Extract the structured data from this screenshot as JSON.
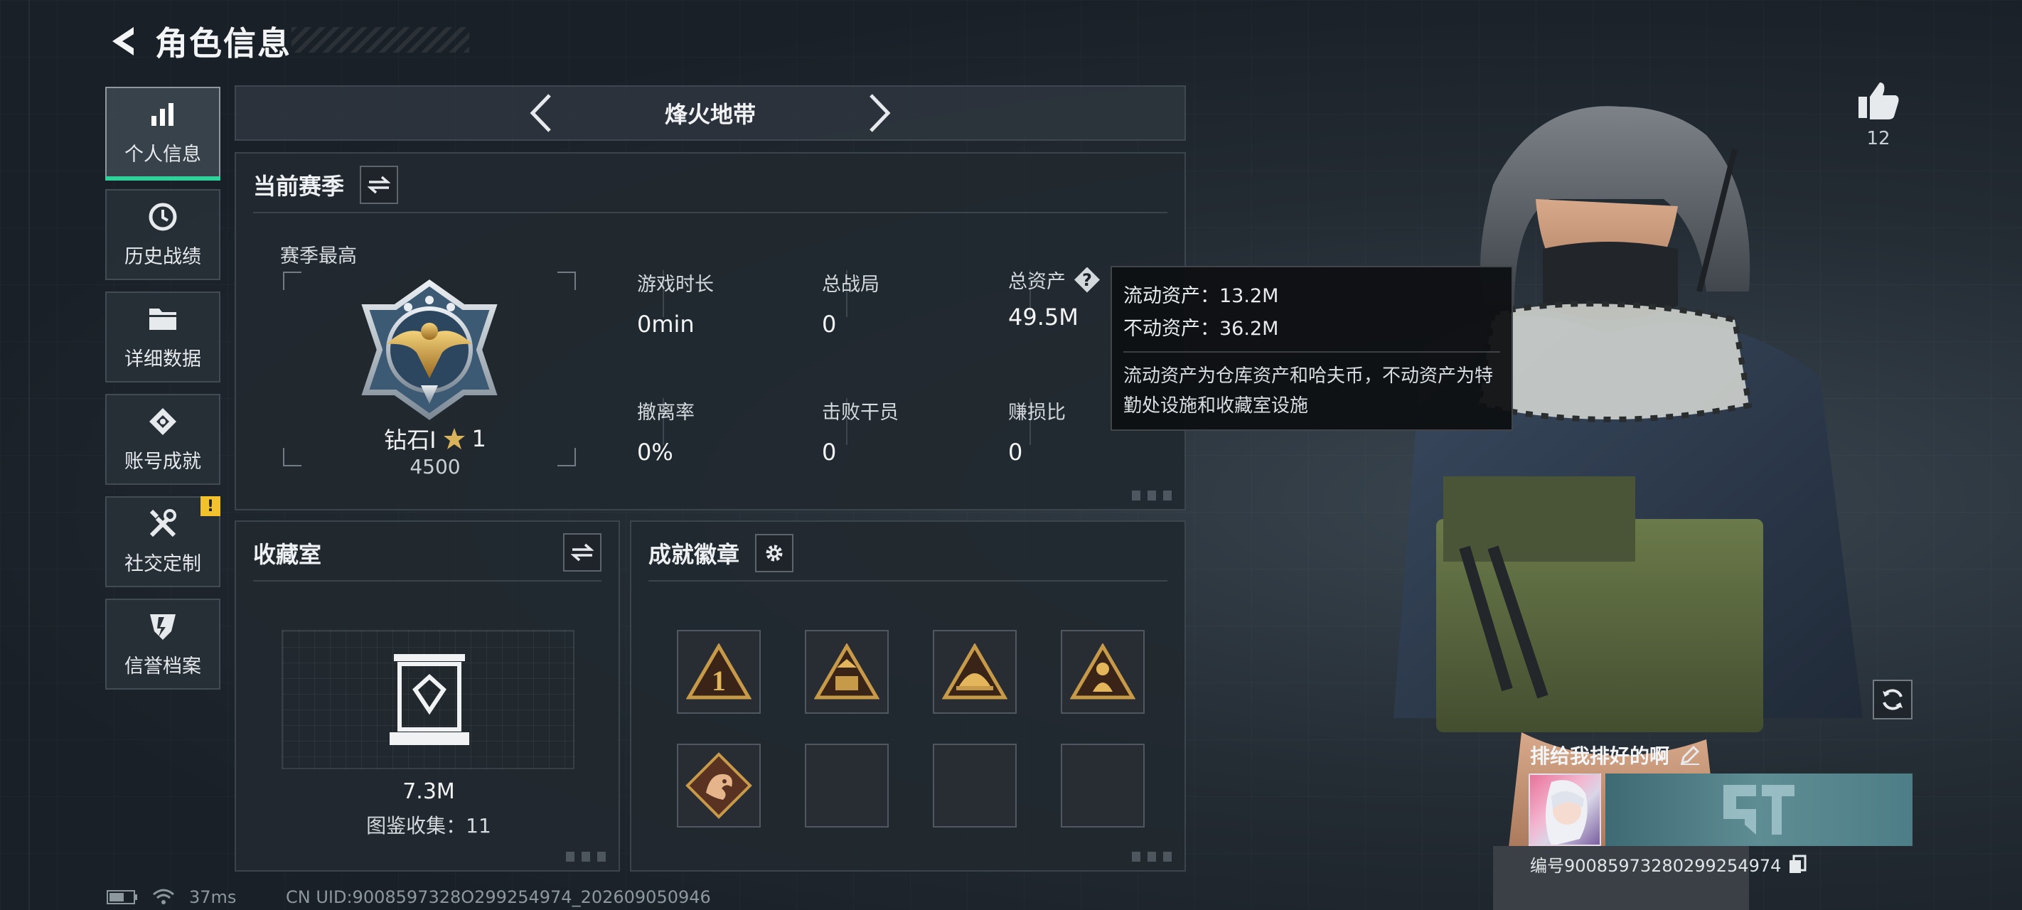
{
  "header": {
    "title": "角色信息"
  },
  "sidebar": {
    "items": [
      {
        "label": "个人信息",
        "icon": "bar-chart-icon",
        "active": true
      },
      {
        "label": "历史战绩",
        "icon": "history-icon"
      },
      {
        "label": "详细数据",
        "icon": "folder-icon"
      },
      {
        "label": "账号成就",
        "icon": "achievement-icon"
      },
      {
        "label": "社交定制",
        "icon": "tools-icon",
        "badge": "!"
      },
      {
        "label": "信誉档案",
        "icon": "shield-icon"
      }
    ]
  },
  "mode": {
    "title": "烽火地带"
  },
  "season": {
    "title": "当前赛季",
    "best_label": "赛季最高",
    "rank_name": "钻石I",
    "rank_stars": "1",
    "rank_score": "4500",
    "stats": [
      {
        "label": "游戏时长",
        "value": "0min"
      },
      {
        "label": "总战局",
        "value": "0"
      },
      {
        "label": "总资产",
        "value": "49.5M"
      },
      {
        "label": "撤离率",
        "value": "0%"
      },
      {
        "label": "击败干员",
        "value": "0"
      },
      {
        "label": "赚损比",
        "value": "0"
      }
    ]
  },
  "tooltip": {
    "liquid": "流动资产：13.2M",
    "fixed": "不动资产：36.2M",
    "description": "流动资产为仓库资产和哈夫币，不动资产为特勤处设施和收藏室设施"
  },
  "collection": {
    "title": "收藏室",
    "value": "7.3M",
    "count_text": "图鉴收集：11"
  },
  "badges": {
    "title": "成就徽章",
    "items": [
      {
        "name": "rank-one-badge",
        "empty": false
      },
      {
        "name": "level-56-badge",
        "empty": false
      },
      {
        "name": "helmet-badge",
        "empty": false
      },
      {
        "name": "soldier-badge",
        "empty": false
      },
      {
        "name": "dragon-badge",
        "empty": false
      },
      {
        "name": "empty-slot",
        "empty": true
      },
      {
        "name": "empty-slot",
        "empty": true
      },
      {
        "name": "empty-slot",
        "empty": true
      }
    ]
  },
  "profile": {
    "likes": "12",
    "nickname": "排给我排好的啊",
    "uid_text": "编号9008597328029925497​4"
  },
  "status": {
    "ping": "37ms",
    "cn_uid": "CN UID:9008597328O299254974_202609050946"
  },
  "colors": {
    "accent": "#2fd29a",
    "warning": "#f2c12e",
    "badge_gold": "#c79a4a"
  }
}
